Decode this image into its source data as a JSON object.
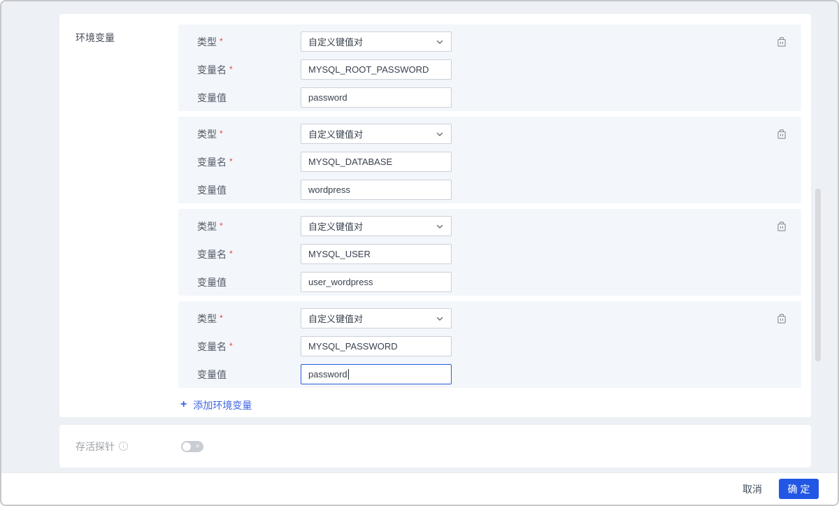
{
  "colors": {
    "accent": "#2257e5",
    "link": "#3d64e2",
    "required": "#df4545",
    "block_bg": "#f3f6fa"
  },
  "env_section": {
    "label": "环境变量",
    "type_label": "类型",
    "name_label": "变量名",
    "value_label": "变量值",
    "required_mark": "*",
    "type_value": "自定义键值对",
    "add_icon": "+",
    "add_link_label": "添加环境变量",
    "entries": [
      {
        "name": "MYSQL_ROOT_PASSWORD",
        "value": "password"
      },
      {
        "name": "MYSQL_DATABASE",
        "value": "wordpress"
      },
      {
        "name": "MYSQL_USER",
        "value": "user_wordpress"
      },
      {
        "name": "MYSQL_PASSWORD",
        "value": "password"
      }
    ]
  },
  "probe_section": {
    "label": "存活探针",
    "info_glyph": "i",
    "toggle_state": "off",
    "toggle_off_glyph": "✕"
  },
  "footer": {
    "cancel_label": "取消",
    "confirm_label": "确 定"
  }
}
